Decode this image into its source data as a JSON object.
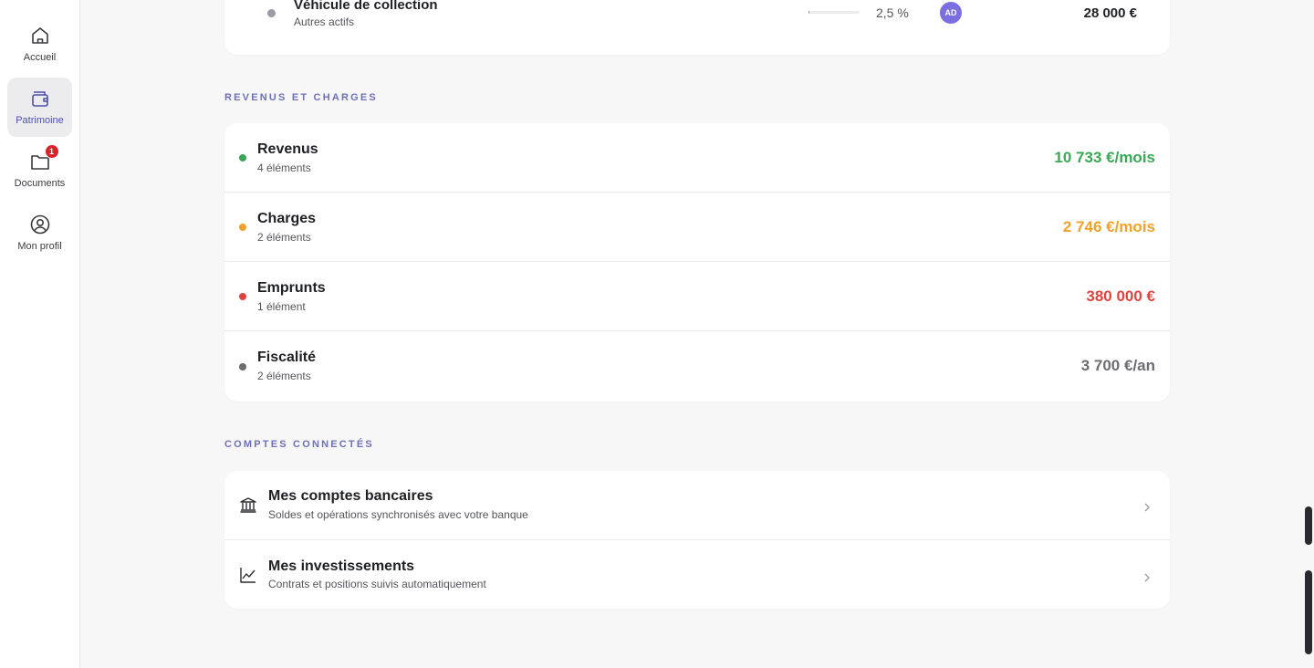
{
  "sidebar": {
    "items": [
      {
        "label": "Accueil",
        "icon": "home-icon",
        "active": false
      },
      {
        "label": "Patrimoine",
        "icon": "wallet-icon",
        "active": true
      },
      {
        "label": "Documents",
        "icon": "folder-icon",
        "active": false,
        "badge": "1"
      },
      {
        "label": "Mon profil",
        "icon": "user-circle-icon",
        "active": false
      }
    ]
  },
  "top_asset": {
    "title": "Véhicule de collection",
    "subtitle": "Autres actifs",
    "share_fraction": 0.025,
    "share_label": "2,5 %",
    "owner_initials": "AD",
    "amount": "28 000 €"
  },
  "revenus_charges": {
    "section_label": "REVENUS ET CHARGES",
    "rows": [
      {
        "title": "Revenus",
        "subtitle": "4 éléments",
        "amount": "10 733 €/mois",
        "color": "#3aa757"
      },
      {
        "title": "Charges",
        "subtitle": "2 éléments",
        "amount": "2 746 €/mois",
        "color": "#f0a12b"
      },
      {
        "title": "Emprunts",
        "subtitle": "1 élément",
        "amount": "380 000 €",
        "color": "#e0443e"
      },
      {
        "title": "Fiscalité",
        "subtitle": "2 éléments",
        "amount": "3 700 €/an",
        "color": "#6c6d72"
      }
    ]
  },
  "comptes": {
    "section_label": "COMPTES CONNECTÉS",
    "rows": [
      {
        "title": "Mes comptes bancaires",
        "subtitle": "Soldes et opérations synchronisés avec votre banque",
        "icon": "bank-icon"
      },
      {
        "title": "Mes investissements",
        "subtitle": "Contrats et positions suivis automatiquement",
        "icon": "chart-line-icon"
      }
    ]
  },
  "colors": {
    "accent": "#6e70b8",
    "avatar": "#7a6ee0",
    "badge": "#d8232a"
  }
}
